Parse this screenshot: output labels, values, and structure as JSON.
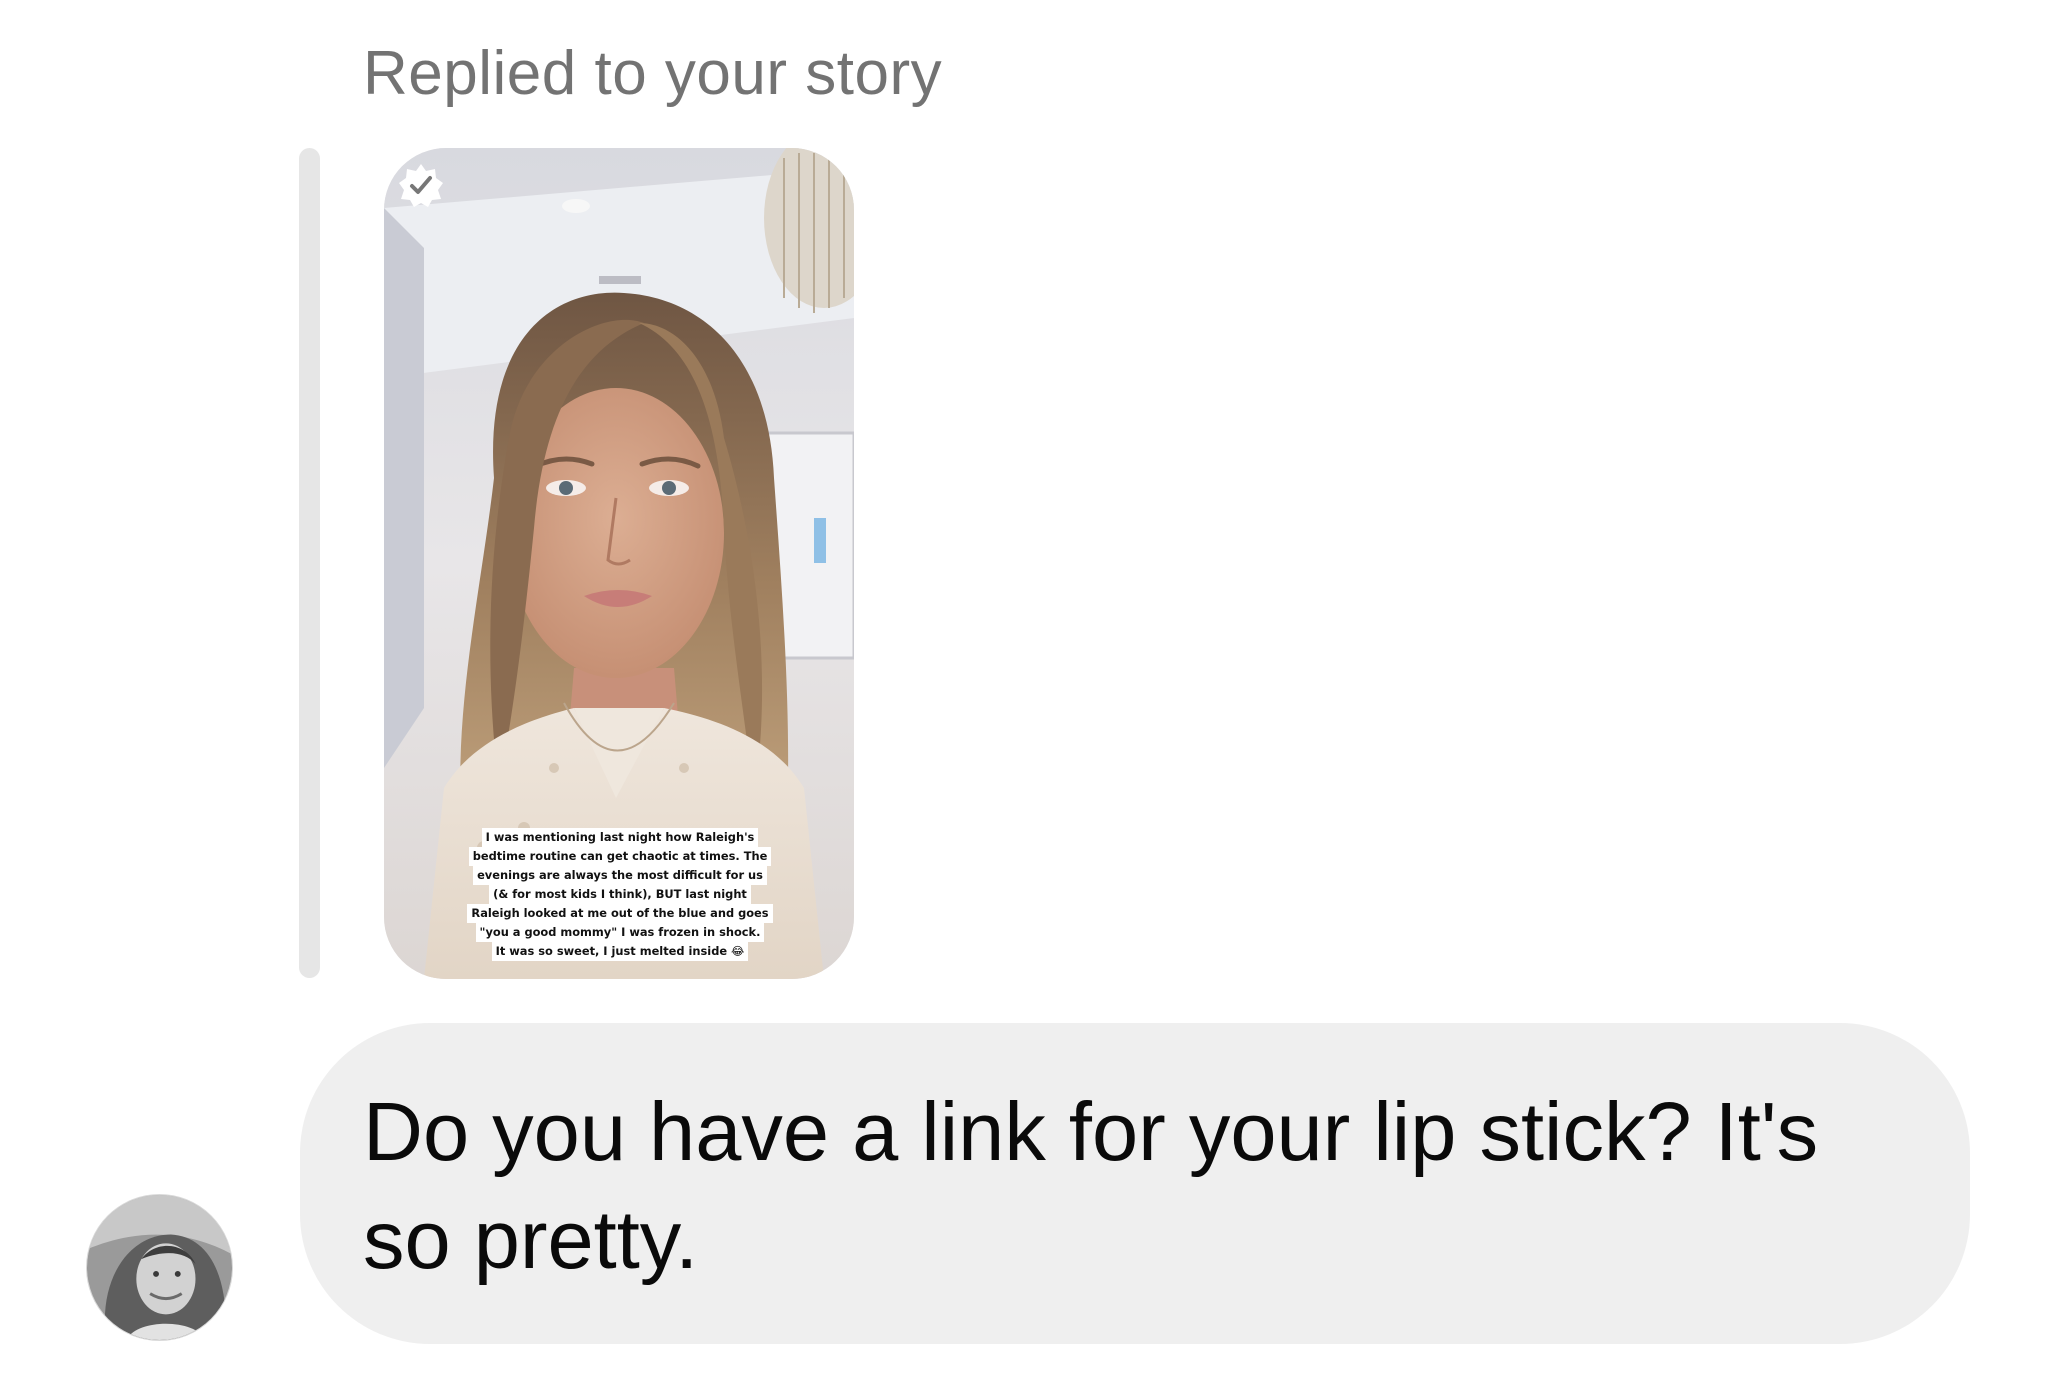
{
  "thread": {
    "reply_header": "Replied to your story",
    "story": {
      "icon": "checkmark-badge-icon",
      "caption_lines": [
        "I was mentioning last night how Raleigh's",
        "bedtime routine can get chaotic at times. The",
        "evenings are always the most difficult for us",
        "(& for most kids I think), BUT last night",
        "Raleigh looked at me out of the blue and goes",
        "\"you a good mommy\" I was frozen in shock.",
        "It was so sweet, I just melted inside 😂"
      ]
    },
    "message": {
      "text": "Do you have a link for your lip stick? It's so pretty."
    },
    "avatar": {
      "icon": "user-avatar-photo"
    }
  },
  "colors": {
    "background": "#ffffff",
    "header_text": "#737373",
    "reply_bar": "#e6e6e6",
    "bubble": "#efefef",
    "message_text": "#0a0a0a"
  }
}
